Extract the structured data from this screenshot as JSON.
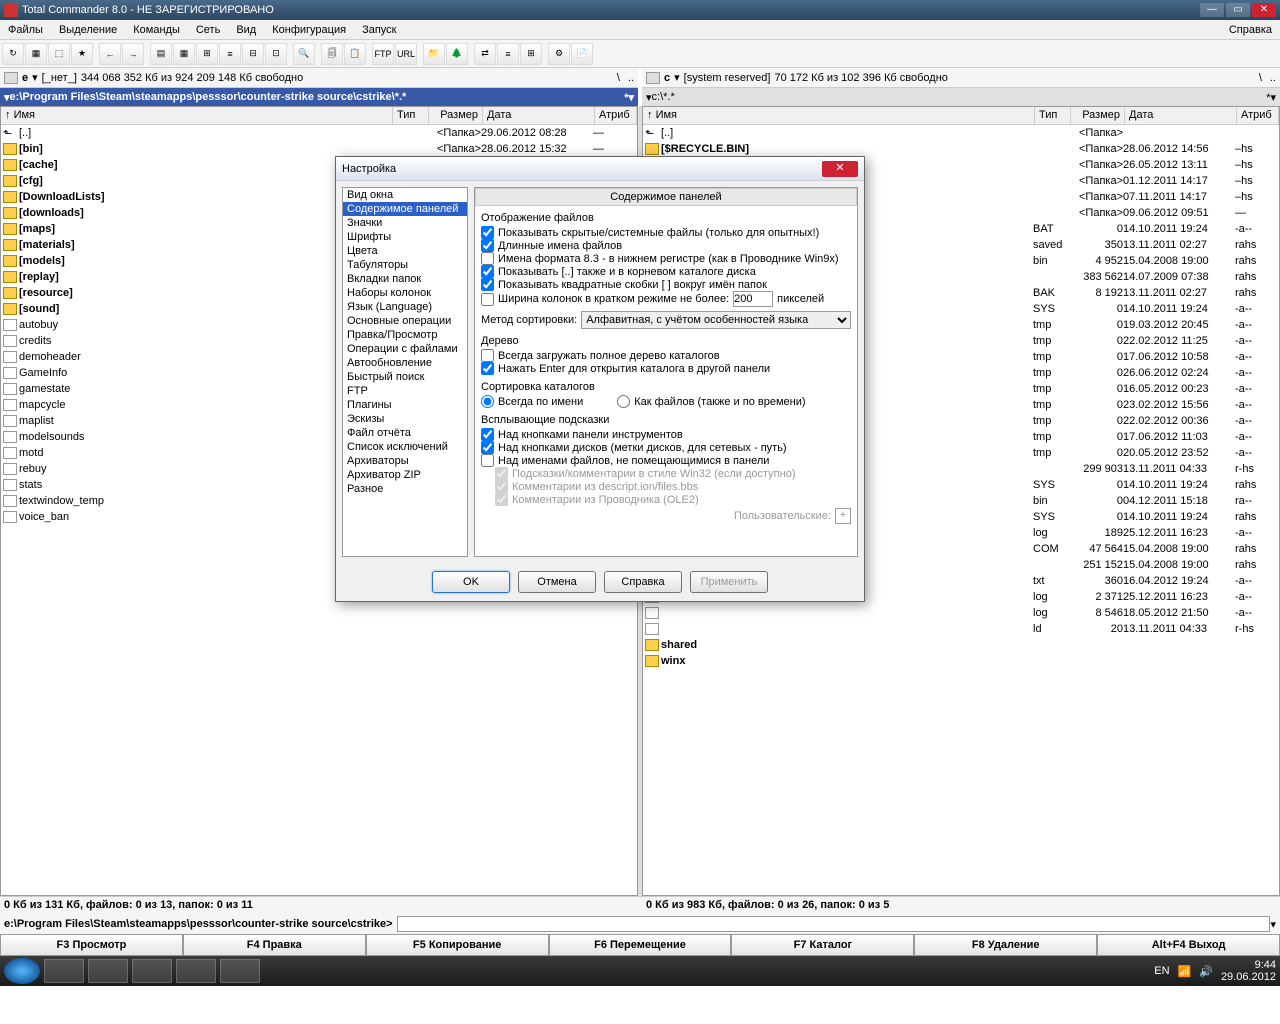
{
  "title": "Total Commander 8.0 - НЕ ЗАРЕГИСТРИРОВАНО",
  "menu": [
    "Файлы",
    "Выделение",
    "Команды",
    "Сеть",
    "Вид",
    "Конфигурация",
    "Запуск"
  ],
  "menu_help": "Справка",
  "drives": {
    "left": {
      "letter": "e",
      "label": "[_нет_]",
      "free": "344 068 352 Кб из 924 209 148 Кб свободно"
    },
    "right": {
      "letter": "c",
      "label": "[system reserved]",
      "free": "70 172 Кб из 102 396 Кб свободно"
    }
  },
  "paths": {
    "left": "e:\\Program Files\\Steam\\steamapps\\pesssor\\counter-strike source\\cstrike\\*.*",
    "right": "c:\\*.*"
  },
  "cols": {
    "name": "Имя",
    "type": "Тип",
    "size": "Размер",
    "date": "Дата",
    "attr": "Атриб"
  },
  "left_files": [
    {
      "icon": "up",
      "name": "[..]",
      "size": "<Папка>",
      "date": "29.06.2012 08:28",
      "attr": "—"
    },
    {
      "icon": "folder",
      "name": "[bin]",
      "size": "<Папка>",
      "date": "28.06.2012 15:32",
      "attr": "—"
    },
    {
      "icon": "folder",
      "name": "[cache]"
    },
    {
      "icon": "folder",
      "name": "[cfg]"
    },
    {
      "icon": "folder",
      "name": "[DownloadLists]"
    },
    {
      "icon": "folder",
      "name": "[downloads]"
    },
    {
      "icon": "folder",
      "name": "[maps]"
    },
    {
      "icon": "folder",
      "name": "[materials]"
    },
    {
      "icon": "folder",
      "name": "[models]"
    },
    {
      "icon": "folder",
      "name": "[replay]"
    },
    {
      "icon": "folder",
      "name": "[resource]"
    },
    {
      "icon": "folder",
      "name": "[sound]"
    },
    {
      "icon": "file",
      "name": "autobuy"
    },
    {
      "icon": "file",
      "name": "credits"
    },
    {
      "icon": "file",
      "name": "demoheader"
    },
    {
      "icon": "file",
      "name": "GameInfo"
    },
    {
      "icon": "file",
      "name": "gamestate"
    },
    {
      "icon": "file",
      "name": "mapcycle"
    },
    {
      "icon": "file",
      "name": "maplist"
    },
    {
      "icon": "file",
      "name": "modelsounds"
    },
    {
      "icon": "file",
      "name": "motd"
    },
    {
      "icon": "file",
      "name": "rebuy"
    },
    {
      "icon": "file",
      "name": "stats"
    },
    {
      "icon": "file",
      "name": "textwindow_temp"
    },
    {
      "icon": "file",
      "name": "voice_ban"
    }
  ],
  "right_files": [
    {
      "icon": "up",
      "name": "[..]",
      "size": "<Папка>",
      "date": "",
      "attr": ""
    },
    {
      "icon": "folder",
      "name": "[$RECYCLE.BIN]",
      "size": "<Папка>",
      "date": "28.06.2012 14:56",
      "attr": "–hs"
    },
    {
      "icon": "blur",
      "name": "",
      "size": "<Папка>",
      "date": "26.05.2012 13:11",
      "attr": "–hs"
    },
    {
      "icon": "blur",
      "name": "",
      "size": "<Папка>",
      "date": "01.12.2011 14:17",
      "attr": "–hs"
    },
    {
      "icon": "blur",
      "name": "",
      "size": "<Папка>",
      "date": "07.11.2011 14:17",
      "attr": "–hs"
    },
    {
      "icon": "blur",
      "name": "",
      "size": "<Папка>",
      "date": "09.06.2012 09:51",
      "attr": "—"
    },
    {
      "icon": "file",
      "name": "",
      "type": "BAT",
      "size": "0",
      "date": "14.10.2011 19:24",
      "attr": "-a--"
    },
    {
      "icon": "file",
      "name": "",
      "type": "saved",
      "size": "350",
      "date": "13.11.2011 02:27",
      "attr": "rahs"
    },
    {
      "icon": "file",
      "name": "",
      "type": "bin",
      "size": "4 952",
      "date": "15.04.2008 19:00",
      "attr": "rahs"
    },
    {
      "icon": "file",
      "name": "",
      "type": "",
      "size": "383 562",
      "date": "14.07.2009 07:38",
      "attr": "rahs"
    },
    {
      "icon": "file",
      "name": "",
      "type": "BAK",
      "size": "8 192",
      "date": "13.11.2011 02:27",
      "attr": "rahs"
    },
    {
      "icon": "file",
      "name": "",
      "type": "SYS",
      "size": "0",
      "date": "14.10.2011 19:24",
      "attr": "-a--"
    },
    {
      "icon": "file",
      "name": "",
      "type": "tmp",
      "size": "0",
      "date": "19.03.2012 20:45",
      "attr": "-a--"
    },
    {
      "icon": "file",
      "name": "",
      "type": "tmp",
      "size": "0",
      "date": "22.02.2012 11:25",
      "attr": "-a--"
    },
    {
      "icon": "file",
      "name": "",
      "type": "tmp",
      "size": "0",
      "date": "17.06.2012 10:58",
      "attr": "-a--"
    },
    {
      "icon": "file",
      "name": "",
      "type": "tmp",
      "size": "0",
      "date": "26.06.2012 02:24",
      "attr": "-a--"
    },
    {
      "icon": "file",
      "name": "",
      "type": "tmp",
      "size": "0",
      "date": "16.05.2012 00:23",
      "attr": "-a--"
    },
    {
      "icon": "file",
      "name": "",
      "type": "tmp",
      "size": "0",
      "date": "23.02.2012 15:56",
      "attr": "-a--"
    },
    {
      "icon": "file",
      "name": "",
      "type": "tmp",
      "size": "0",
      "date": "22.02.2012 00:36",
      "attr": "-a--"
    },
    {
      "icon": "file",
      "name": "",
      "type": "tmp",
      "size": "0",
      "date": "17.06.2012 11:03",
      "attr": "-a--"
    },
    {
      "icon": "file",
      "name": "",
      "type": "tmp",
      "size": "0",
      "date": "20.05.2012 23:52",
      "attr": "-a--"
    },
    {
      "icon": "file",
      "name": "",
      "type": "",
      "size": "299 903",
      "date": "13.11.2011 04:33",
      "attr": "r-hs"
    },
    {
      "icon": "file",
      "name": "",
      "type": "SYS",
      "size": "0",
      "date": "14.10.2011 19:24",
      "attr": "rahs"
    },
    {
      "icon": "file",
      "name": "",
      "type": "bin",
      "size": "0",
      "date": "04.12.2011 15:18",
      "attr": "ra--"
    },
    {
      "icon": "file",
      "name": "",
      "type": "SYS",
      "size": "0",
      "date": "14.10.2011 19:24",
      "attr": "rahs"
    },
    {
      "icon": "file",
      "name": "",
      "type": "log",
      "size": "189",
      "date": "25.12.2011 16:23",
      "attr": "-a--"
    },
    {
      "icon": "file",
      "name": "",
      "type": "COM",
      "size": "47 564",
      "date": "15.04.2008 19:00",
      "attr": "rahs"
    },
    {
      "icon": "file",
      "name": "",
      "type": "",
      "size": "251 152",
      "date": "15.04.2008 19:00",
      "attr": "rahs"
    },
    {
      "icon": "file",
      "name": "",
      "type": "txt",
      "size": "360",
      "date": "16.04.2012 19:24",
      "attr": "-a--"
    },
    {
      "icon": "file",
      "name": "",
      "type": "log",
      "size": "2 371",
      "date": "25.12.2011 16:23",
      "attr": "-a--"
    },
    {
      "icon": "file",
      "name": "",
      "type": "log",
      "size": "8 546",
      "date": "18.05.2012 21:50",
      "attr": "-a--"
    },
    {
      "icon": "file",
      "name": "",
      "type": "ld",
      "size": "20",
      "date": "13.11.2011 04:33",
      "attr": "r-hs"
    },
    {
      "icon": "folder",
      "name": "shared"
    },
    {
      "icon": "folder",
      "name": "winx"
    }
  ],
  "status": {
    "left": "0 Кб из 131 Кб, файлов: 0 из 13, папок: 0 из 11",
    "right": "0 Кб из 983 Кб, файлов: 0 из 26, папок: 0 из 5"
  },
  "cmd_prompt": "e:\\Program Files\\Steam\\steamapps\\pesssor\\counter-strike source\\cstrike>",
  "fn": [
    "F3 Просмотр",
    "F4 Правка",
    "F5 Копирование",
    "F6 Перемещение",
    "F7 Каталог",
    "F8 Удаление",
    "Alt+F4 Выход"
  ],
  "tray": {
    "lang": "EN",
    "time": "9:44",
    "date": "29.06.2012"
  },
  "dialog": {
    "title": "Настройка",
    "tree": [
      "Вид окна",
      "Содержимое панелей",
      "Значки",
      "Шрифты",
      "Цвета",
      "Табуляторы",
      "Вкладки папок",
      "Наборы колонок",
      "Язык (Language)",
      "Основные операции",
      "Правка/Просмотр",
      "Операции с файлами",
      "Автообновление",
      "Быстрый поиск",
      "FTP",
      "Плагины",
      "Эскизы",
      "Файл отчёта",
      "Список исключений",
      "Архиваторы",
      "Архиватор ZIP",
      "Разное"
    ],
    "tree_sel": 1,
    "panel_title": "Содержимое панелей",
    "grp1": "Отображение файлов",
    "cb_hidden": "Показывать скрытые/системные файлы (только для опытных!)",
    "cb_long": "Длинные имена файлов",
    "cb_83": "Имена формата 8.3 - в нижнем регистре (как в Проводнике Win9x)",
    "cb_dotdot": "Показывать [..] также и в корневом каталоге диска",
    "cb_brackets": "Показывать квадратные скобки [ ] вокруг имён папок",
    "cb_width": "Ширина колонок в кратком режиме не более:",
    "width_val": "200",
    "width_unit": "пикселей",
    "sort_label": "Метод сортировки:",
    "sort_val": "Алфавитная, с учётом особенностей языка",
    "grp2": "Дерево",
    "cb_tree_full": "Всегда загружать полное дерево каталогов",
    "cb_tree_enter": "Нажать Enter для открытия каталога в другой панели",
    "grp3": "Сортировка каталогов",
    "rb_name": "Всегда по имени",
    "rb_files": "Как файлов (также и по времени)",
    "grp4": "Всплывающие подсказки",
    "cb_tb": "Над кнопками панели инструментов",
    "cb_drives": "Над кнопками дисков (метки дисков, для сетевых - путь)",
    "cb_names": "Над именами файлов, не помещающимися в панели",
    "cb_win32": "Подсказки/комментарии в стиле Win32 (если доступно)",
    "cb_descript": "Комментарии из descript.ion/files.bbs",
    "cb_ole2": "Комментарии из Проводника (OLE2)",
    "user_label": "Пользовательские:",
    "btn_ok": "OK",
    "btn_cancel": "Отмена",
    "btn_help": "Справка",
    "btn_apply": "Применить"
  }
}
